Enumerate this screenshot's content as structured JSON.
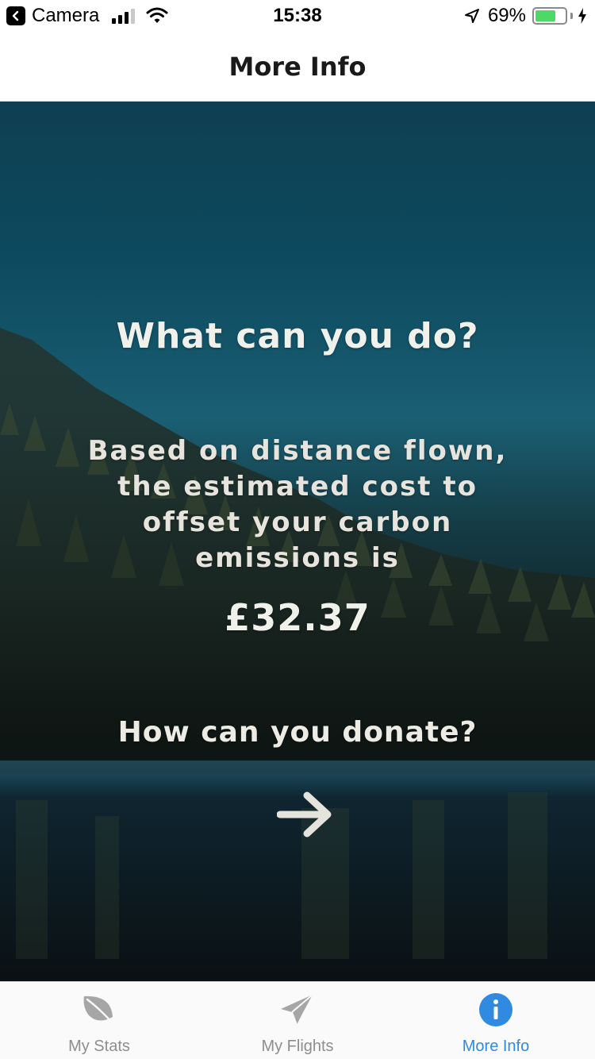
{
  "status_bar": {
    "back_app": "Camera",
    "time": "15:38",
    "battery_percent": "69%",
    "battery_level": 0.69,
    "battery_color": "#4cd964"
  },
  "nav": {
    "title": "More Info"
  },
  "main": {
    "heading": "What can you do?",
    "body": "Based on distance flown, the estimated cost to offset your carbon emissions is",
    "amount": "£32.37",
    "donate_question": "How can you donate?",
    "next_icon": "arrow-right-icon"
  },
  "tabs": [
    {
      "label": "My Stats",
      "icon": "leaf-icon",
      "active": false
    },
    {
      "label": "My Flights",
      "icon": "paper-plane-icon",
      "active": false
    },
    {
      "label": "More Info",
      "icon": "info-icon",
      "active": true
    }
  ],
  "colors": {
    "active_tab": "#2f8ae0",
    "inactive_tab": "#8e8e8e"
  }
}
